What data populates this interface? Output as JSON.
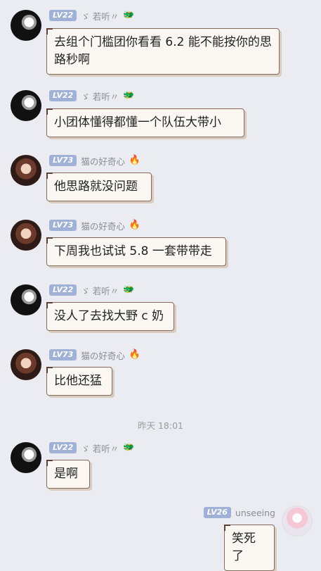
{
  "messages": [
    {
      "level": "LV22",
      "nick": "ゞ 若听〃",
      "badge": "🐲",
      "text": "去组个门槛团你看看 6.2 能不能按你的思路秒啊"
    },
    {
      "level": "LV22",
      "nick": "ゞ 若听〃",
      "badge": "🐲",
      "text": "小团体懂得都懂一个队伍大带小"
    },
    {
      "level": "LV73",
      "nick": "猫の好奇心",
      "badge": "🔥",
      "text": "他思路就没问题"
    },
    {
      "level": "LV73",
      "nick": "猫の好奇心",
      "badge": "🔥",
      "text": "下周我也试试 5.8 一套带带走"
    },
    {
      "level": "LV22",
      "nick": "ゞ 若听〃",
      "badge": "🐲",
      "text": "没人了去找大野 c 奶"
    },
    {
      "level": "LV73",
      "nick": "猫の好奇心",
      "badge": "🔥",
      "text": "比他还猛"
    },
    {
      "level": "LV22",
      "nick": "ゞ 若听〃",
      "badge": "🐲",
      "text": "是啊"
    }
  ],
  "timestamp": "昨天 18:01",
  "self_message": {
    "level": "LV26",
    "nick": "unseeing",
    "text": "笑死了"
  },
  "colors": {
    "background": "#ebecf1",
    "level_badge": "#9fb1d6",
    "bubble_border": "#8a6a58"
  }
}
